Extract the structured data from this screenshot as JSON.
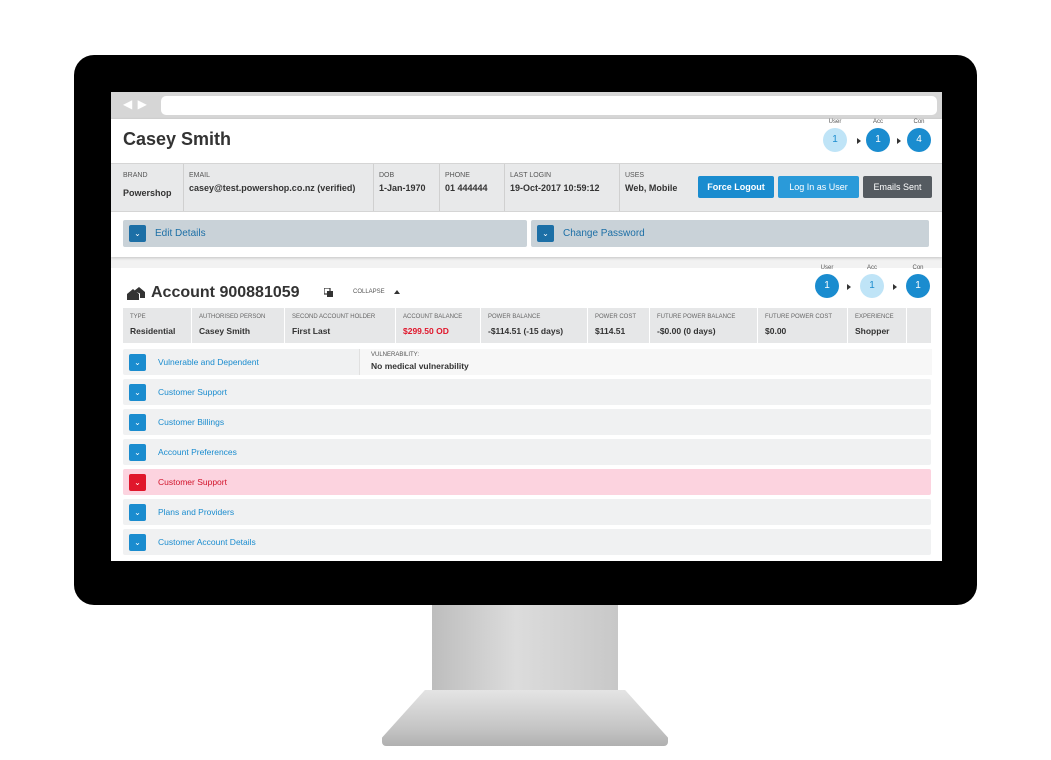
{
  "browser": {
    "nav_arrows": "◀ ▶"
  },
  "customer": {
    "name": "Casey Smith",
    "flow": [
      {
        "label": "User",
        "count": "1",
        "state": "light"
      },
      {
        "label": "Acc",
        "count": "1",
        "state": "active"
      },
      {
        "label": "Con",
        "count": "4",
        "state": "active"
      }
    ],
    "info": [
      {
        "key": "BRAND",
        "value": "Powershop"
      },
      {
        "key": "EMAIL",
        "value": "casey@test.powershop.co.nz (verified)"
      },
      {
        "key": "DOB",
        "value": "1-Jan-1970"
      },
      {
        "key": "PHONE",
        "value": "01 444444"
      },
      {
        "key": "LAST LOGIN",
        "value": "19-Oct-2017 10:59:12"
      },
      {
        "key": "USES",
        "value": "Web, Mobile"
      }
    ],
    "buttons": {
      "force_logout": "Force Logout",
      "log_in_as_user": "Log In as User",
      "emails_sent": "Emails Sent"
    },
    "panels": {
      "edit_details": "Edit Details",
      "change_password": "Change Password"
    }
  },
  "account": {
    "title": "Account 900881059",
    "collapse_label": "COLLAPSE",
    "flow": [
      {
        "label": "User",
        "count": "1",
        "state": "active"
      },
      {
        "label": "Acc",
        "count": "1",
        "state": "light"
      },
      {
        "label": "Con",
        "count": "1",
        "state": "active"
      }
    ],
    "info": [
      {
        "key": "TYPE",
        "value": "Residential"
      },
      {
        "key": "AUTHORISED PERSON",
        "value": "Casey Smith"
      },
      {
        "key": "SECOND ACCOUNT HOLDER",
        "value": "First Last"
      },
      {
        "key": "ACCOUNT BALANCE",
        "value": "$299.50 OD",
        "alert": true
      },
      {
        "key": "POWER BALANCE",
        "value": "-$114.51 (-15 days)"
      },
      {
        "key": "POWER COST",
        "value": "$114.51"
      },
      {
        "key": "FUTURE POWER BALANCE",
        "value": "-$0.00 (0 days)"
      },
      {
        "key": "FUTURE POWER COST",
        "value": "$0.00"
      },
      {
        "key": "EXPERIENCE",
        "value": "Shopper"
      }
    ],
    "vulnerability": {
      "key": "VULNERABILITY:",
      "value": "No medical vulnerability"
    },
    "sections": [
      {
        "label": "Vulnerable and Dependent"
      },
      {
        "label": "Customer Support"
      },
      {
        "label": "Customer Billings"
      },
      {
        "label": "Account Preferences"
      },
      {
        "label": "Customer Support",
        "alert": true
      },
      {
        "label": "Plans and Providers"
      },
      {
        "label": "Customer Account Details"
      }
    ],
    "colors": {
      "accent": "#1a8ccf",
      "alert": "#e0162b",
      "alert_bg": "#fcd3df"
    }
  }
}
